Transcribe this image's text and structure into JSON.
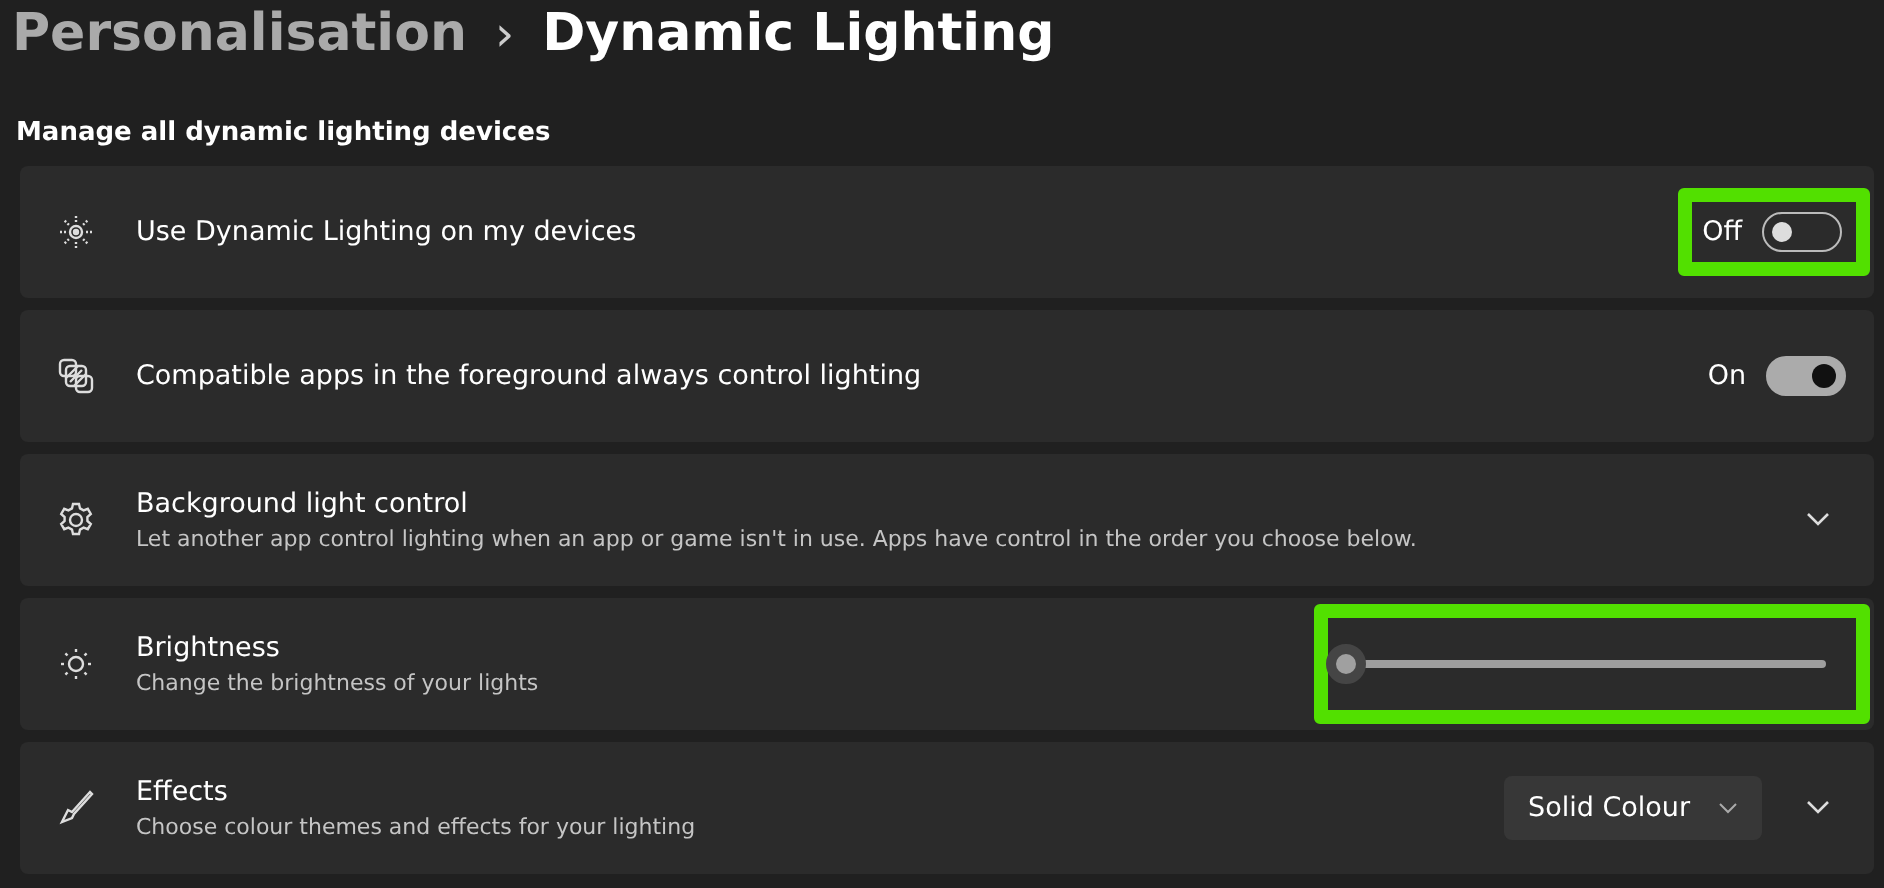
{
  "breadcrumb": {
    "parent": "Personalisation",
    "separator": "›",
    "current": "Dynamic Lighting"
  },
  "section_heading": "Manage all dynamic lighting devices",
  "settings": [
    {
      "kind": "toggle",
      "title": "Use Dynamic Lighting on my devices",
      "state_label": "Off",
      "on": false,
      "highlighted": true
    },
    {
      "kind": "toggle",
      "title": "Compatible apps in the foreground always control lighting",
      "state_label": "On",
      "on": true,
      "highlighted": false
    },
    {
      "kind": "expander",
      "title": "Background light control",
      "description": "Let another app control lighting when an app or game isn't in use. Apps have control in the order you choose below.",
      "expanded": false,
      "highlighted": false
    },
    {
      "kind": "slider",
      "title": "Brightness",
      "description": "Change the brightness of your lights",
      "level": 0,
      "disabled": true,
      "highlighted": true
    },
    {
      "kind": "dropdown",
      "title": "Effects",
      "description": "Choose colour themes and effects for your lighting",
      "value": "Solid Colour",
      "expanded": false,
      "highlighted": false
    }
  ]
}
